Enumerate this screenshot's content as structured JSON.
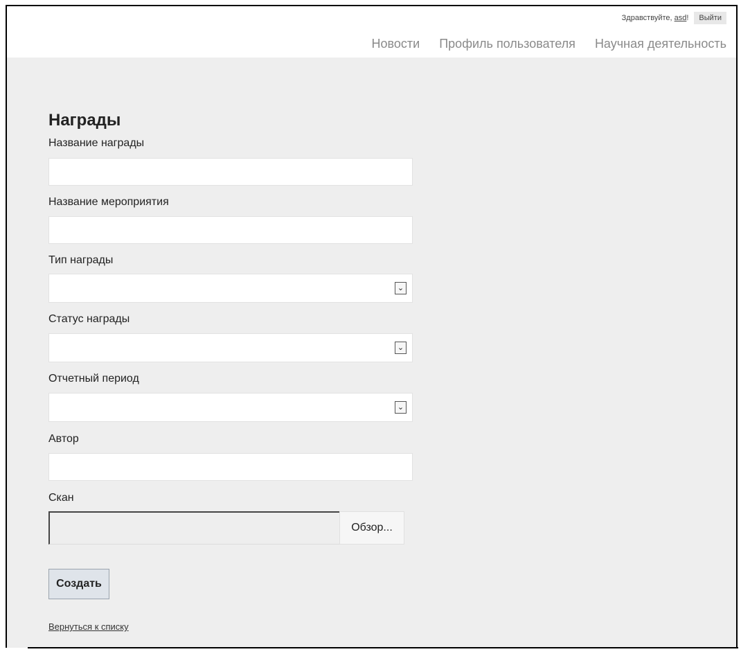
{
  "header": {
    "greeting_prefix": "Здравствуйте, ",
    "username": "asd",
    "greeting_suffix": "!",
    "logout_label": "Выйти",
    "nav": [
      "Новости",
      "Профиль пользователя",
      "Научная деятельность"
    ]
  },
  "form": {
    "title": "Награды",
    "fields": {
      "award_name": {
        "label": "Название награды",
        "value": ""
      },
      "event_name": {
        "label": "Название мероприятия",
        "value": ""
      },
      "award_type": {
        "label": "Тип награды",
        "value": ""
      },
      "award_status": {
        "label": "Статус награды",
        "value": ""
      },
      "report_period": {
        "label": "Отчетный период",
        "value": ""
      },
      "author": {
        "label": "Автор",
        "value": ""
      },
      "scan": {
        "label": "Скан",
        "value": "",
        "browse_label": "Обзор..."
      }
    },
    "submit_label": "Создать",
    "back_label": "Вернуться к списку"
  },
  "icons": {
    "select_arrow": "chevron-down-icon"
  },
  "colors": {
    "content_bg": "#eeeeee",
    "nav_text": "#8a8a8a",
    "create_button_bg": "#dfe4ea"
  }
}
